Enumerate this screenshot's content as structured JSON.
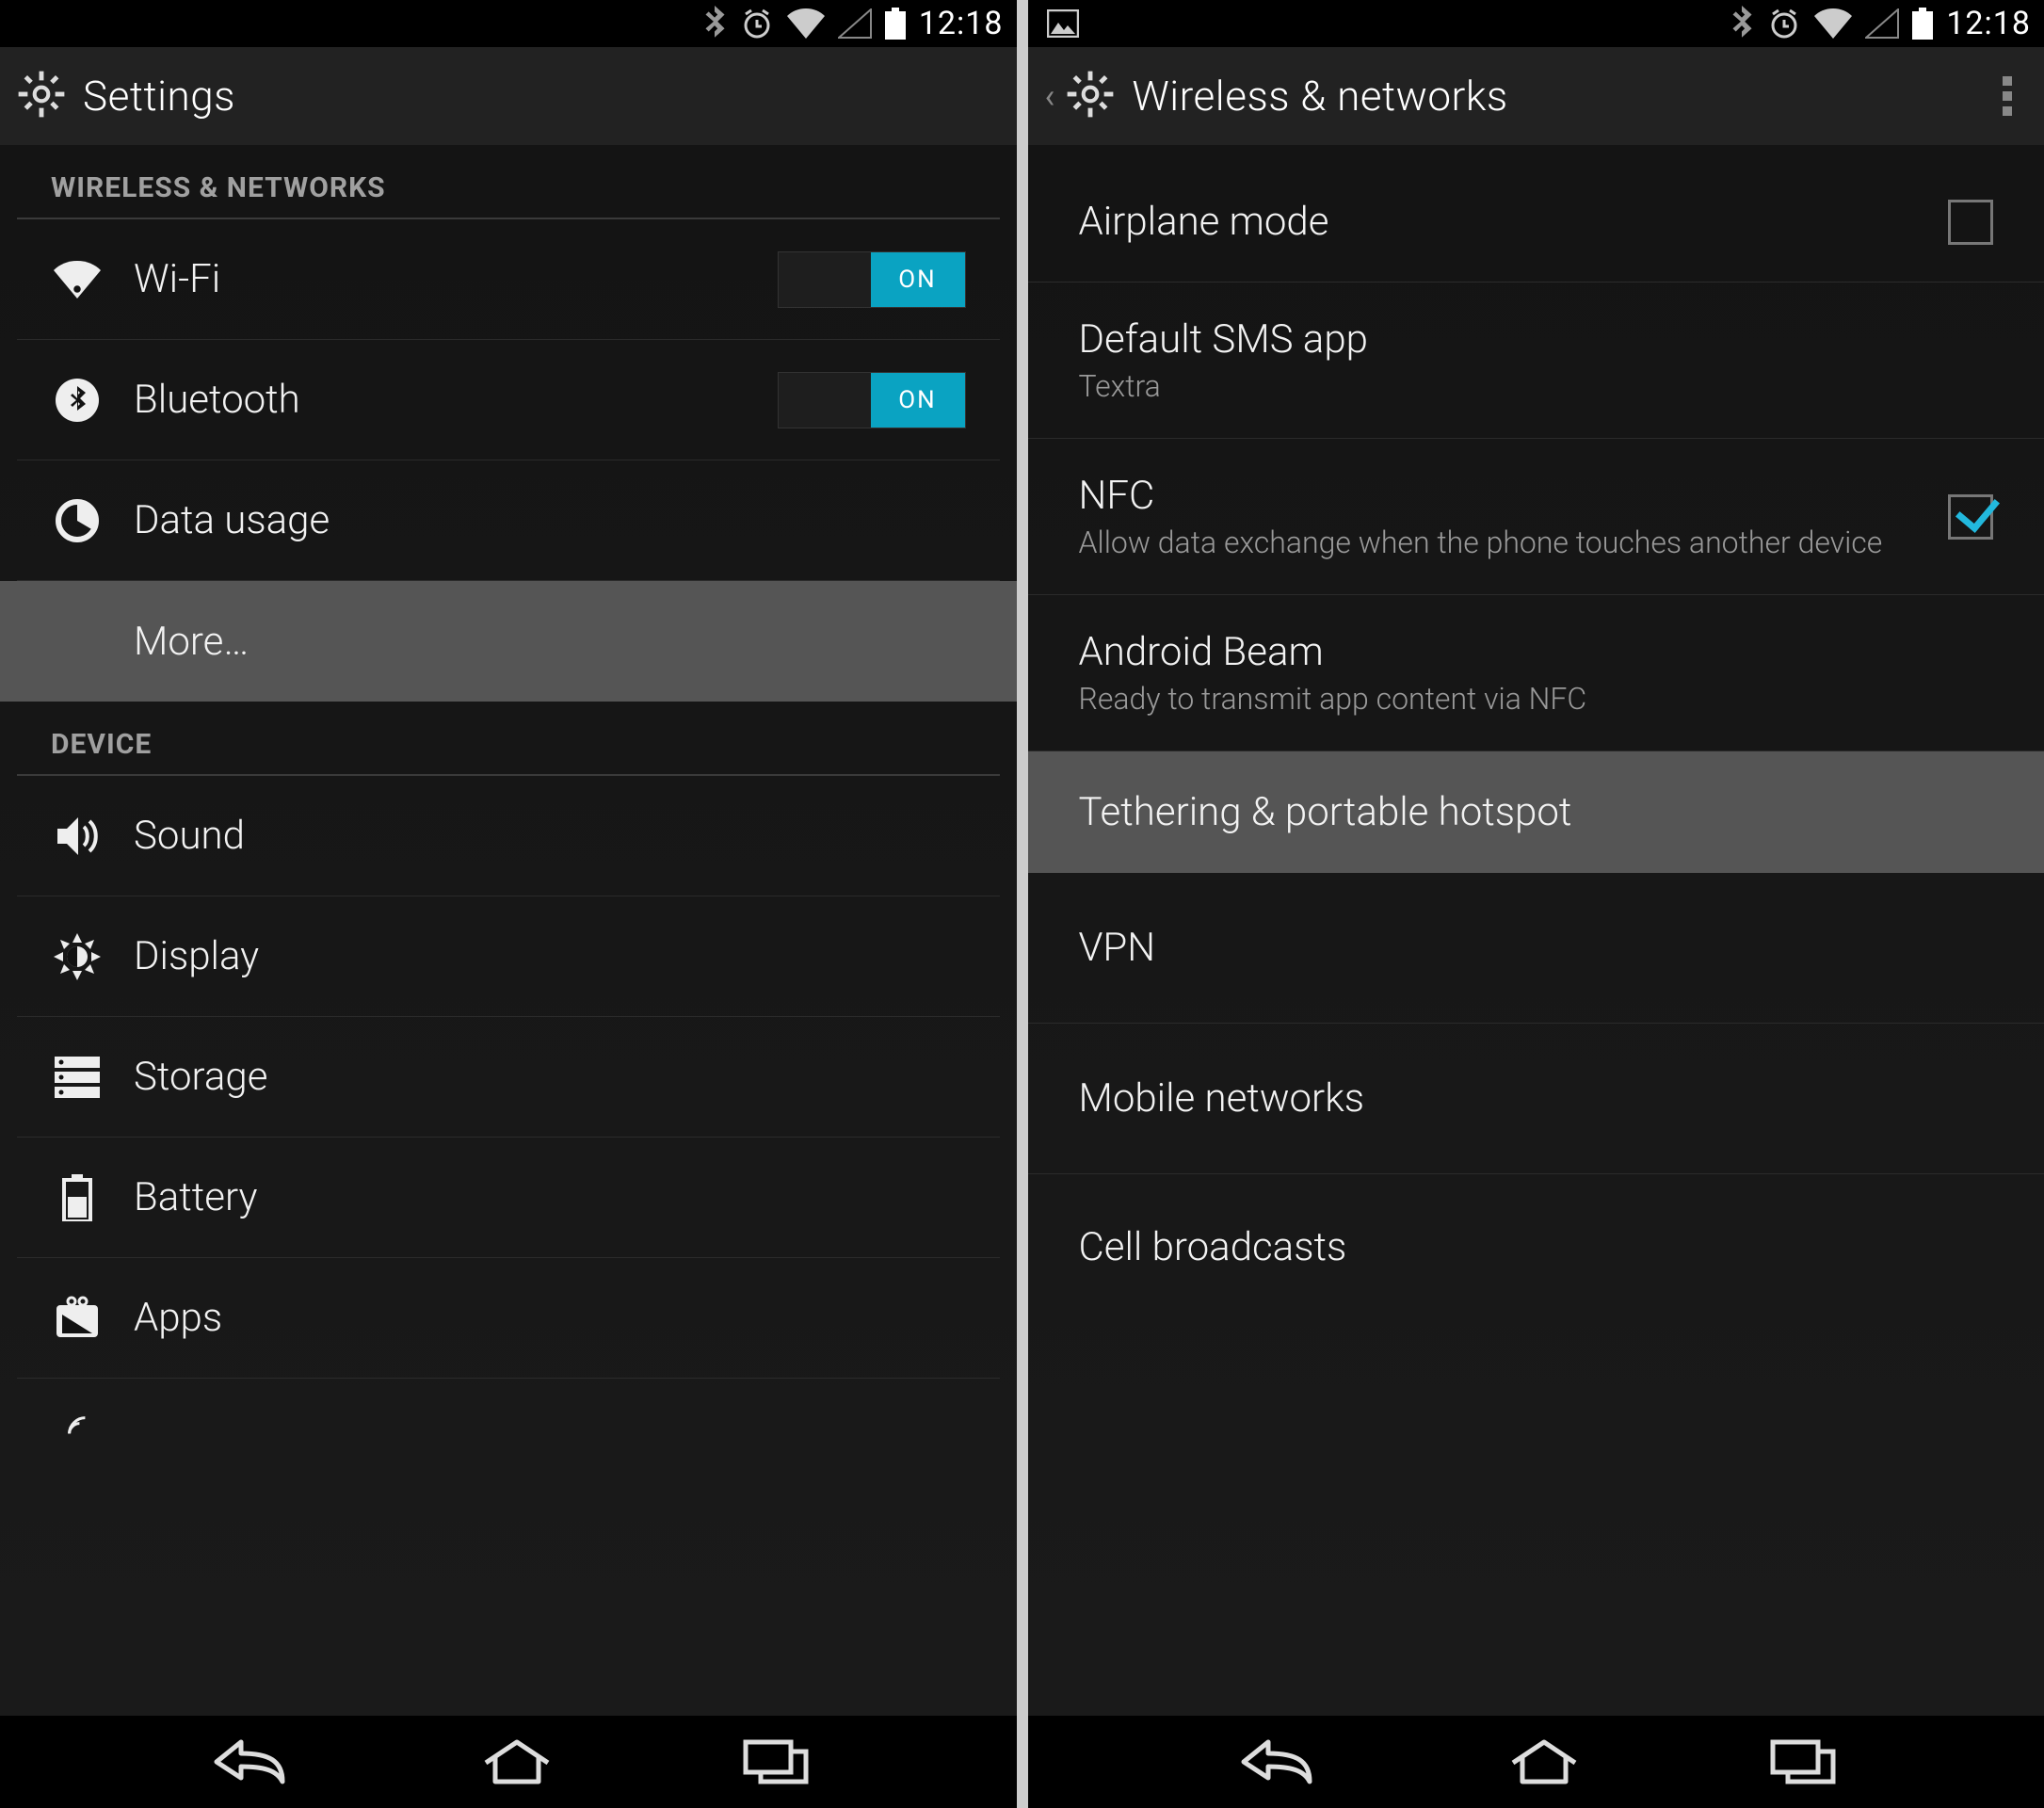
{
  "status": {
    "time": "12:18"
  },
  "left": {
    "title": "Settings",
    "section1": "Wireless & networks",
    "section2": "Device",
    "wifi": "Wi-Fi",
    "bt": "Bluetooth",
    "data": "Data usage",
    "more": "More…",
    "sound": "Sound",
    "display": "Display",
    "storage": "Storage",
    "battery": "Battery",
    "apps": "Apps",
    "toggle_on": "ON"
  },
  "right": {
    "title": "Wireless & networks",
    "airplane": "Airplane mode",
    "sms_title": "Default SMS app",
    "sms_sub": "Textra",
    "nfc_title": "NFC",
    "nfc_sub": "Allow data exchange when the phone touches another device",
    "beam_title": "Android Beam",
    "beam_sub": "Ready to transmit app content via NFC",
    "tether": "Tethering & portable hotspot",
    "vpn": "VPN",
    "mobile": "Mobile networks",
    "cell": "Cell broadcasts"
  }
}
